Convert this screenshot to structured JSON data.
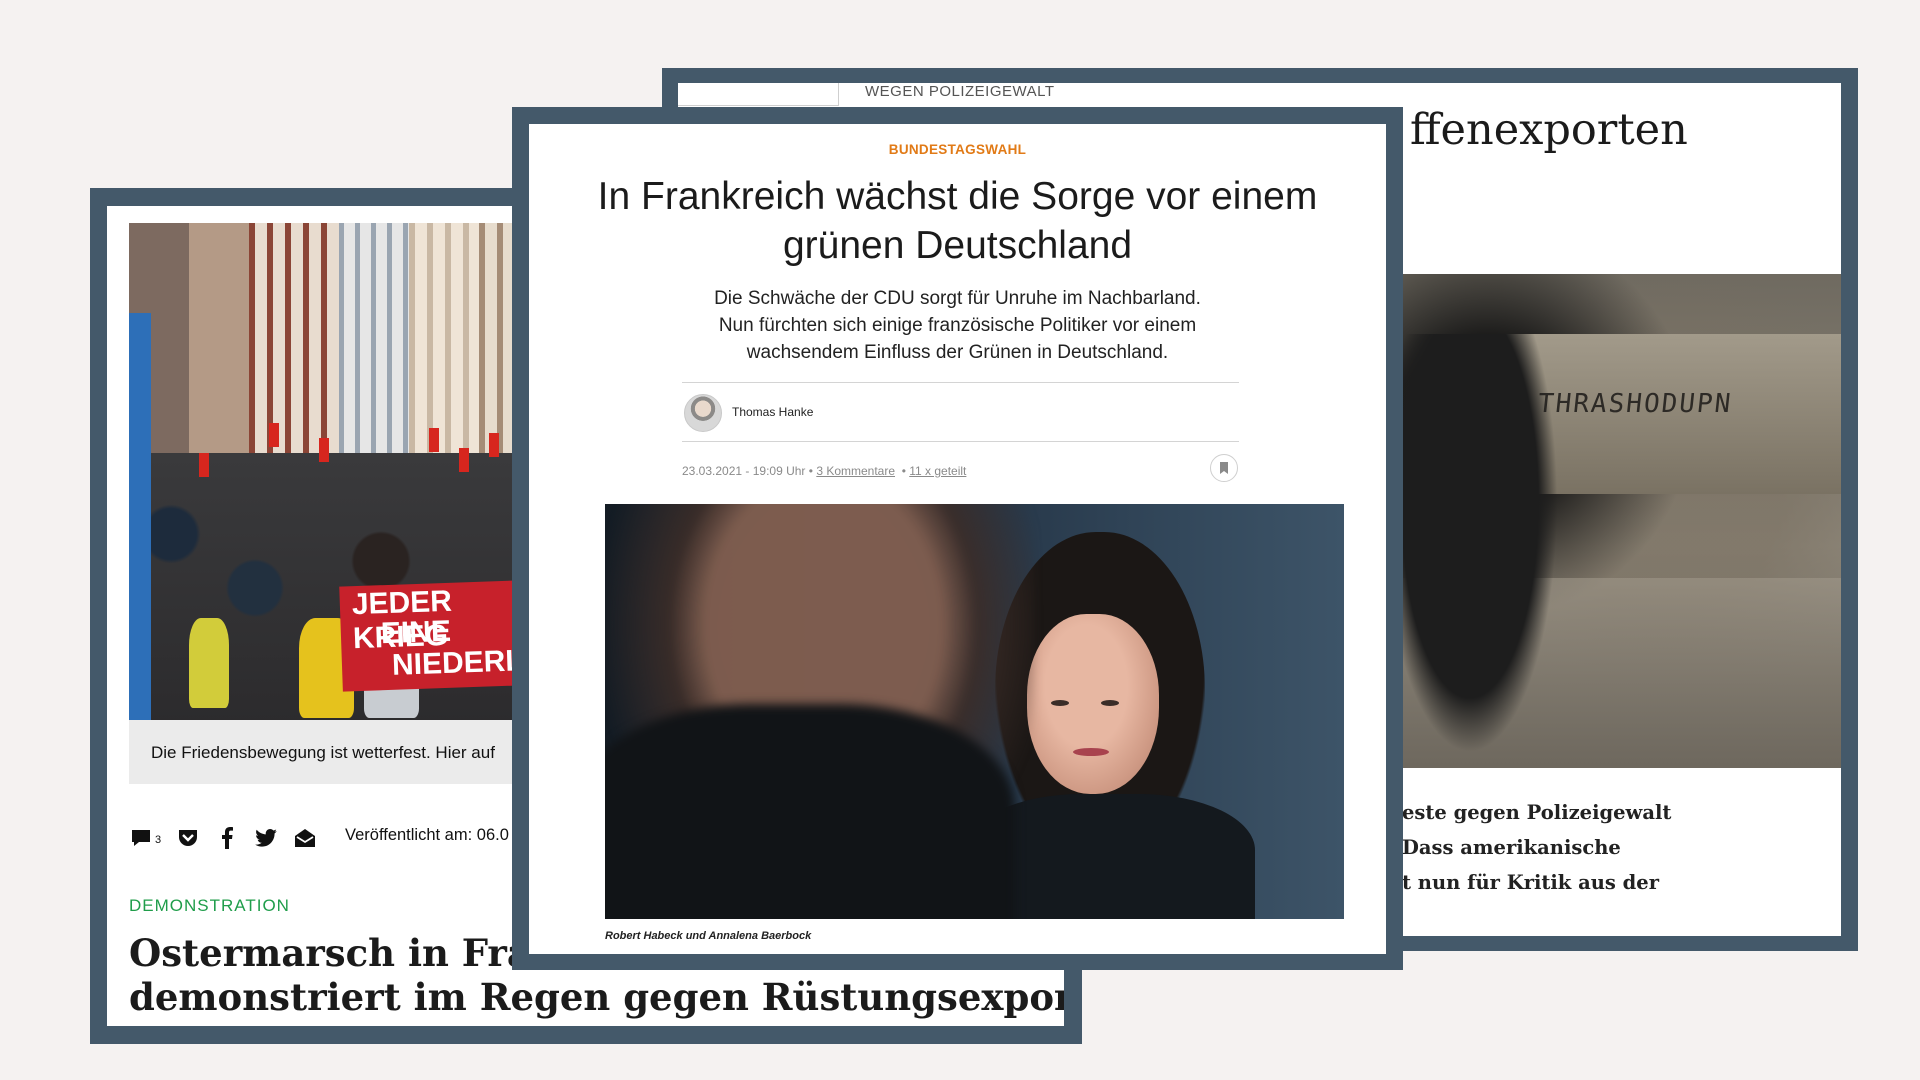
{
  "right_card": {
    "kicker": "WEGEN POLIZEIGEWALT",
    "title": "ffenexporten",
    "photo_graffiti": "THRASHODUPN",
    "caption_lines": [
      "este gegen Polizeigewalt",
      "Dass amerikanische",
      "t nun für Kritik aus der"
    ]
  },
  "left_card": {
    "photo_caption": "Die Friedensbewegung ist wetterfest. Hier auf",
    "banner_lines": [
      "JEDER KRIEG",
      "EINE",
      "NIEDERLAGE"
    ],
    "comments_count": "3",
    "published": "Veröffentlicht am: 06.0",
    "kicker": "DEMONSTRATION",
    "title_lines": [
      "Ostermarsch in Frank",
      "demonstriert im Regen gegen Rüstungsexporte"
    ],
    "icons": [
      "comment-icon",
      "pocket-icon",
      "facebook-icon",
      "twitter-icon",
      "mail-icon"
    ]
  },
  "center_card": {
    "kicker": "BUNDESTAGSWAHL",
    "title_lines": [
      "In Frankreich wächst die Sorge vor einem",
      "grünen Deutschland"
    ],
    "lead_lines": [
      "Die Schwäche der CDU sorgt für Unruhe im Nachbarland.",
      "Nun fürchten sich einige französische Politiker vor einem",
      "wachsendem Einfluss der Grünen in Deutschland."
    ],
    "author": "Thomas Hanke",
    "date": "23.03.2021 - 19:09 Uhr",
    "comments": "3 Kommentare",
    "shares": "11 x geteilt",
    "photo_caption": "Robert Habeck und Annalena Baerbock"
  },
  "colors": {
    "background": "#f5f2f1",
    "frame": "#44596a",
    "center_kicker": "#e17a16",
    "left_kicker": "#1f9d4a"
  }
}
